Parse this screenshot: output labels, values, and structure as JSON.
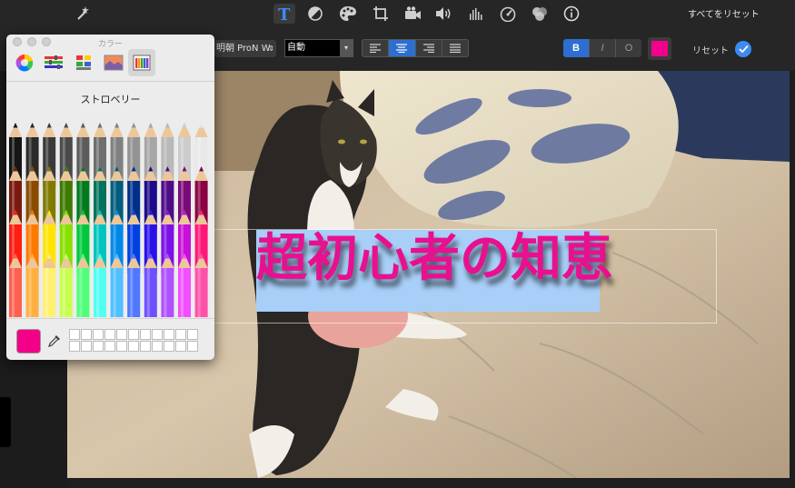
{
  "toolbar": {
    "icons": [
      "magic-wand-icon",
      "text-icon",
      "color-balance-icon",
      "palette-icon",
      "crop-icon",
      "camera-icon",
      "volume-icon",
      "equalizer-icon",
      "speed-icon",
      "filter-icon",
      "info-icon"
    ],
    "reset_all": "すべてをリセット"
  },
  "text_settings": {
    "font": "明朝 ProN W",
    "size": "自動",
    "styles": [
      "B",
      "I",
      "O"
    ],
    "color": "#f2008a",
    "reset": "リセット"
  },
  "viewer": {
    "title": "超初心者の知恵"
  },
  "color_panel": {
    "title": "カラー",
    "crayon_name": "ストロベリー",
    "current_color": "#f20088",
    "pencil_rows": [
      [
        "#151515",
        "#2a2a2a",
        "#3a3a3a",
        "#4a4a4a",
        "#5c5c5c",
        "#6e6e6e",
        "#808080",
        "#939393",
        "#a6a6a6",
        "#b9b9b9",
        "#cccccc",
        "#e8e8e8"
      ],
      [
        "#7a1a0e",
        "#8a4a00",
        "#7f7a00",
        "#3f7a00",
        "#007a1e",
        "#00735e",
        "#005c7f",
        "#002f8a",
        "#1a0a8a",
        "#4f0a8a",
        "#7a0a7a",
        "#8a0042"
      ],
      [
        "#ff1c10",
        "#ff7a00",
        "#ffe400",
        "#88e000",
        "#00c83c",
        "#00c4c0",
        "#0088e8",
        "#0040e0",
        "#2a10e8",
        "#7d10e8",
        "#c810d8",
        "#ff1878"
      ],
      [
        "#ff6050",
        "#ffb040",
        "#fff070",
        "#c8ff50",
        "#50ff78",
        "#50fff0",
        "#50c0ff",
        "#5078ff",
        "#6f50ff",
        "#b050ff",
        "#f050ff",
        "#ff50a8"
      ]
    ]
  }
}
